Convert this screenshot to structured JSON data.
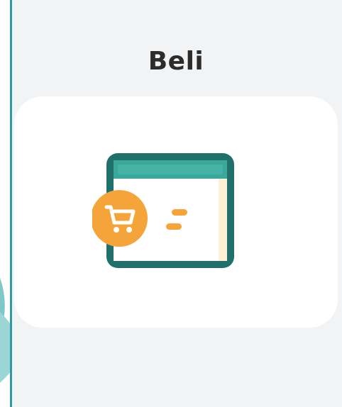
{
  "menu_item": {
    "title": "Beli",
    "icon": "shopping-cart-browser-icon"
  },
  "colors": {
    "frame_teal": "#1f8c83",
    "header_teal": "#3aa89b",
    "window_cream": "#fdf0d4",
    "badge_orange": "#f5a43a",
    "panel_bg": "#f2f3f5",
    "decor_teal": "#7fc8c9"
  }
}
